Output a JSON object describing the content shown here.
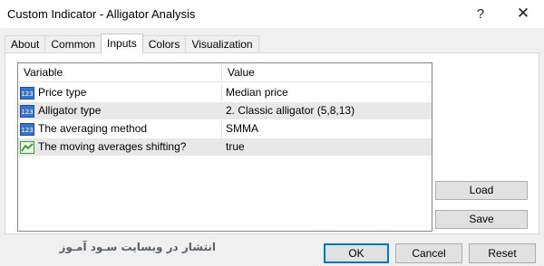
{
  "window": {
    "title": "Custom Indicator - Alligator Analysis",
    "help_glyph": "?",
    "close_glyph": "✕"
  },
  "tabs": [
    {
      "label": "About"
    },
    {
      "label": "Common"
    },
    {
      "label": "Inputs",
      "active": true
    },
    {
      "label": "Colors"
    },
    {
      "label": "Visualization"
    }
  ],
  "inputs_table": {
    "headers": {
      "variable": "Variable",
      "value": "Value"
    },
    "rows": [
      {
        "icon": "numeric-123-icon",
        "variable": "Price type",
        "value": "Median price"
      },
      {
        "icon": "numeric-123-icon",
        "variable": "Alligator type",
        "value": "2. Classic alligator (5,8,13)"
      },
      {
        "icon": "numeric-123-icon",
        "variable": "The averaging method",
        "value": "SMMA"
      },
      {
        "icon": "boolean-chart-icon",
        "variable": "The  moving averages shifting?",
        "value": "true"
      }
    ]
  },
  "side_buttons": {
    "load": "Load",
    "save": "Save"
  },
  "footer_buttons": {
    "ok": "OK",
    "cancel": "Cancel",
    "reset": "Reset"
  },
  "watermark": "انتشار در وبسایت سـود آمـوز",
  "colors": {
    "accent": "#0078d7",
    "row_alt": "#e8e8e8"
  }
}
